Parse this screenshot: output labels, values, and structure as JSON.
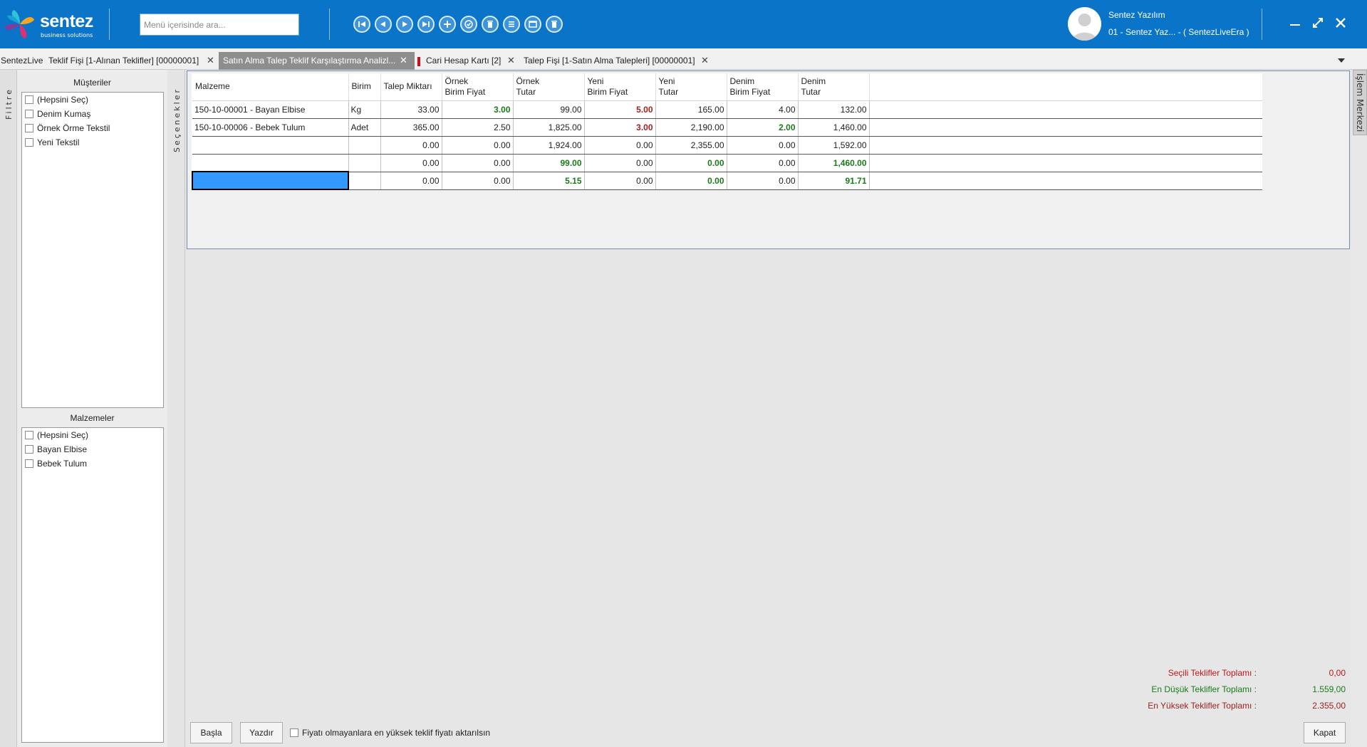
{
  "brand": {
    "name": "sentez",
    "tagline": "business solutions"
  },
  "search": {
    "placeholder": "Menü içerisinde ara..."
  },
  "toolbar": {
    "icons": [
      "first-icon",
      "previous-icon",
      "next-icon",
      "last-icon",
      "add-icon",
      "approve-icon",
      "delete-icon",
      "list-icon",
      "window-icon",
      "trash-icon"
    ]
  },
  "user": {
    "name": "Sentez Yazılım",
    "company": "01 - Sentez Yaz... - ( SentezLiveEra )"
  },
  "tabs": [
    {
      "label": "SentezLive",
      "closable": false
    },
    {
      "label": "Teklif Fişi  [1-Alınan Teklifler] [00000001]",
      "closable": true
    },
    {
      "label": "Satın Alma Talep Teklif Karşılaştırma Analizl...",
      "closable": true,
      "active": true
    },
    {
      "label": "Cari Hesap Kartı [2]",
      "closable": true
    },
    {
      "label": "Talep Fişi  [1-Satın Alma Talepleri] [00000001]",
      "closable": true
    }
  ],
  "sidebar": {
    "filter_label": "Filtre",
    "options_label": "Seçenekler",
    "right_label": "İşlem Merkezi",
    "customers_title": "Müşteriler",
    "customers": [
      "(Hepsini Seç)",
      "Denim Kumaş",
      "Örnek Örme Tekstil",
      "Yeni Tekstil"
    ],
    "materials_title": "Malzemeler",
    "materials": [
      "(Hepsini Seç)",
      "Bayan Elbise",
      "Bebek Tulum"
    ]
  },
  "grid": {
    "headers": [
      {
        "l1": "Malzeme",
        "l2": ""
      },
      {
        "l1": "Birim",
        "l2": ""
      },
      {
        "l1": "Talep Miktarı",
        "l2": ""
      },
      {
        "l1": "Örnek",
        "l2": "Birim Fiyat"
      },
      {
        "l1": "Örnek",
        "l2": "Tutar"
      },
      {
        "l1": "Yeni",
        "l2": "Birim Fiyat"
      },
      {
        "l1": "Yeni",
        "l2": "Tutar"
      },
      {
        "l1": "Denim",
        "l2": "Birim Fiyat"
      },
      {
        "l1": "Denim",
        "l2": "Tutar"
      }
    ],
    "rows": [
      {
        "cells": [
          "150-10-00001 - Bayan Elbise",
          "Kg",
          "33.00",
          "3.00",
          "99.00",
          "5.00",
          "165.00",
          "4.00",
          "132.00"
        ],
        "styles": [
          "",
          "",
          "",
          "g",
          "",
          "r",
          "",
          "",
          ""
        ]
      },
      {
        "cells": [
          "150-10-00006 - Bebek Tulum",
          "Adet",
          "365.00",
          "2.50",
          "1,825.00",
          "3.00",
          "2,190.00",
          "2.00",
          "1,460.00"
        ],
        "styles": [
          "",
          "",
          "",
          "",
          "",
          "r",
          "",
          "g",
          ""
        ]
      },
      {
        "cells": [
          "",
          "",
          "0.00",
          "0.00",
          "1,924.00",
          "0.00",
          "2,355.00",
          "0.00",
          "1,592.00"
        ],
        "styles": [
          "",
          "",
          "",
          "",
          "",
          "",
          "",
          "",
          ""
        ]
      },
      {
        "cells": [
          "",
          "",
          "0.00",
          "0.00",
          "99.00",
          "0.00",
          "0.00",
          "0.00",
          "1,460.00"
        ],
        "styles": [
          "",
          "",
          "",
          "",
          "g",
          "",
          "g",
          "",
          "g"
        ]
      },
      {
        "cells": [
          "",
          "",
          "0.00",
          "0.00",
          "5.15",
          "0.00",
          "0.00",
          "0.00",
          "91.71"
        ],
        "styles": [
          "sel",
          "",
          "",
          "",
          "g",
          "",
          "g",
          "",
          "g"
        ]
      }
    ]
  },
  "summary": {
    "selected_label": "Seçili Teklifler Toplamı :",
    "selected_value": "0,00",
    "selected_color": "#c0161b",
    "lowest_label": "En Düşük Teklifler Toplamı :",
    "lowest_value": "1.559,00",
    "lowest_color": "#1b7a1b",
    "highest_label": "En Yüksek Teklifler Toplamı :",
    "highest_value": "2.355,00",
    "highest_color": "#a32020"
  },
  "footer": {
    "start_label": "Başla",
    "print_label": "Yazdır",
    "checkbox_label": "Fiyatı olmayanlara en yüksek teklif fiyatı aktarılsın",
    "close_label": "Kapat"
  }
}
